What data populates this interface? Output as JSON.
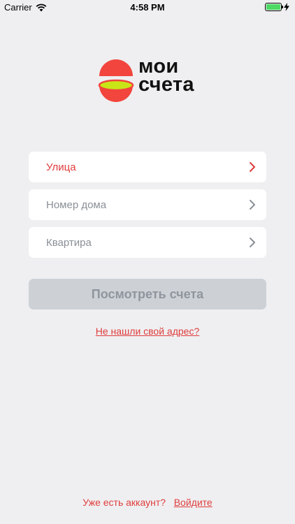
{
  "status_bar": {
    "carrier": "Carrier",
    "time": "4:58 PM",
    "battery_level": 1.0,
    "icons": [
      "wifi-icon",
      "battery-icon",
      "charging-bolt-icon"
    ]
  },
  "logo": {
    "line1": "мои",
    "line2": "счета",
    "colors": {
      "red": "#f2453d",
      "green": "#c8e617"
    }
  },
  "form": {
    "street_label": "Улица",
    "house_label": "Номер дома",
    "apartment_label": "Квартира",
    "submit_label": "Посмотреть счета"
  },
  "links": {
    "not_found": "Не нашли свой адрес?",
    "have_account": "Уже есть аккаунт?",
    "login": "Войдите"
  },
  "colors": {
    "accent": "#e03c3c",
    "background": "#efeff1",
    "disabled_button": "#cdd1d6"
  }
}
